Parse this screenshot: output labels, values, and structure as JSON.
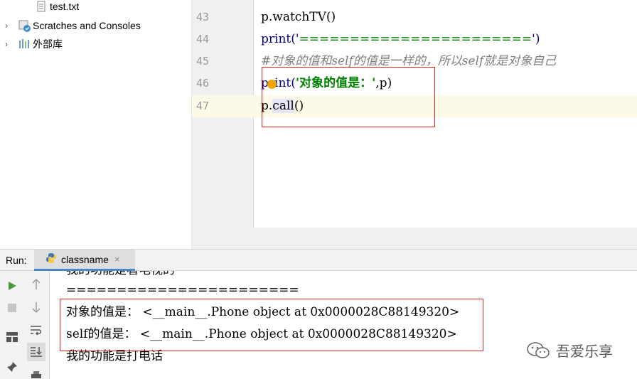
{
  "project_tree": {
    "items": [
      {
        "label": "test.txt",
        "icon": "text-file-icon"
      },
      {
        "label": "Scratches and Consoles",
        "icon": "scratches-icon",
        "arrow": "›"
      },
      {
        "label": "外部库",
        "icon": "library-icon",
        "arrow": "›"
      }
    ]
  },
  "editor": {
    "lines": [
      {
        "no": "43",
        "code": "p.watchTV()"
      },
      {
        "no": "44",
        "code_a": "print('",
        "code_b": "=======================",
        "code_c": "')"
      },
      {
        "no": "45",
        "code": "#对象的值和self的值是一样的，所以self就是对象自己"
      },
      {
        "no": "46",
        "code_a": "print(",
        "code_b": "'对象的值是：'",
        "code_c": ",p)"
      },
      {
        "no": "47",
        "code_a": "p.",
        "code_b": "call",
        "code_c": "()"
      }
    ]
  },
  "run": {
    "label": "Run:",
    "tab": "classname",
    "close": "×",
    "output": [
      "我的功能是看电视的",
      "=======================",
      "对象的值是： <__main__.Phone object at 0x0000028C88149320>",
      "self的值是： <__main__.Phone object at 0x0000028C88149320>",
      "我的功能是打电话"
    ]
  },
  "watermark": {
    "text": "吾爱乐享"
  },
  "colors": {
    "keyword": "#000080",
    "string": "#008000",
    "comment": "#808080",
    "annotation": "#dd2222",
    "run_green": "#4a9a3d"
  }
}
